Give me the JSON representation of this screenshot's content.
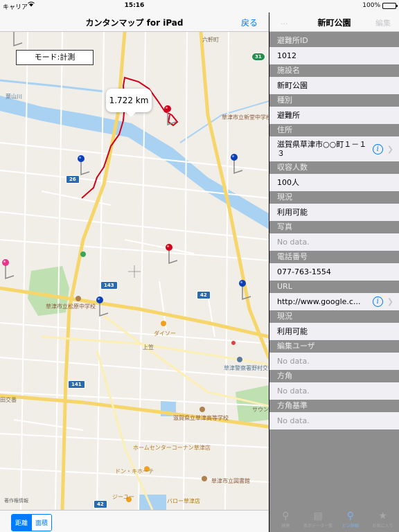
{
  "status": {
    "carrier": "キャリア",
    "time": "15:16",
    "battery": "100%",
    "battery_level": 1.0
  },
  "map_nav": {
    "title": "カンタンマップ for iPad",
    "back_label": "戻る"
  },
  "map": {
    "mode_label": "モード:計測",
    "distance_callout": "1.722 km",
    "legal_label": "著作権情報",
    "labels": {
      "rokkenmachi": "六軒町",
      "hayamagawa": "葉山川",
      "kusatsu_shinmachi_school": "草津市立新堂中学校",
      "kusatsu_matsubara_school": "草津市立松原中学校",
      "daiso": "ダイソー",
      "kamigasa": "上笠",
      "police_koban": "草津警察署野村交番",
      "takedai": "田交番",
      "kusatsu_high_school": "滋賀県立草津高等学校",
      "home_center": "ホームセンターコーナン草津店",
      "donkihote": "ドン・キホーテ",
      "jiyu": "ジーユー",
      "valor": "バロー草津店",
      "library": "草津市立図書館",
      "saikun": "サウン"
    },
    "route_shields": {
      "r31": "31",
      "r26": "26",
      "r143": "143",
      "r42a": "42",
      "r141": "141",
      "r42b": "42"
    },
    "pin_colors": {
      "red": "#d0021b",
      "blue": "#0a3fb8",
      "pink": "#e8358a"
    }
  },
  "map_toolbar": {
    "segments": [
      "距離",
      "面積"
    ],
    "active_segment": "距離"
  },
  "detail": {
    "back_label": "...",
    "title": "新町公園",
    "edit_label": "編集",
    "fields": [
      {
        "header": "避難所ID",
        "value": "1012"
      },
      {
        "header": "施設名",
        "value": "新町公園"
      },
      {
        "header": "種別",
        "value": "避難所"
      },
      {
        "header": "住所",
        "value": "滋賀県草津市○○町１－１３",
        "info": true
      },
      {
        "header": "収容人数",
        "value": "100人"
      },
      {
        "header": "現況",
        "value": "利用可能"
      },
      {
        "header": "写真",
        "value": "No data.",
        "nodata": true
      },
      {
        "header": "電話番号",
        "value": "077-763-1554"
      },
      {
        "header": "URL",
        "value": "http://www.google.c...",
        "info": true
      },
      {
        "header": "現況",
        "value": "利用可能"
      },
      {
        "header": "編集ユーザ",
        "value": "No data.",
        "nodata": true
      },
      {
        "header": "方角",
        "value": "No data.",
        "nodata": true
      },
      {
        "header": "方角基準",
        "value": "No data.",
        "nodata": true
      }
    ]
  },
  "tab_bar": {
    "tabs": [
      {
        "label": "検索",
        "icon": "search-icon"
      },
      {
        "label": "表示データ一覧",
        "icon": "list-icon"
      },
      {
        "label": "ピン詳細",
        "icon": "pin-icon"
      },
      {
        "label": "お気に入り",
        "icon": "star-icon"
      }
    ],
    "active_tab": "ピン詳細"
  }
}
